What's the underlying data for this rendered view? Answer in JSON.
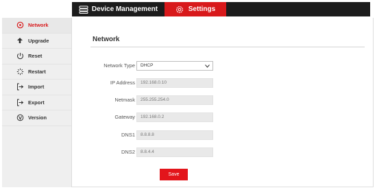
{
  "header": {
    "tabs": [
      {
        "label": "Device Management",
        "icon": "device-management-icon"
      },
      {
        "label": "Settings",
        "icon": "gear-icon",
        "active": true
      }
    ]
  },
  "sidebar": {
    "items": [
      {
        "label": "Network",
        "icon": "network-icon",
        "active": true
      },
      {
        "label": "Upgrade",
        "icon": "upgrade-arrow-icon"
      },
      {
        "label": "Reset",
        "icon": "reset-icon"
      },
      {
        "label": "Restart",
        "icon": "restart-icon"
      },
      {
        "label": "Import",
        "icon": "import-icon"
      },
      {
        "label": "Export",
        "icon": "export-icon"
      },
      {
        "label": "Version",
        "icon": "version-icon"
      }
    ]
  },
  "main": {
    "title": "Network",
    "fields": [
      {
        "label": "Network Type",
        "value": "DHCP",
        "type": "select"
      },
      {
        "label": "IP Address",
        "value": "192.168.0.10"
      },
      {
        "label": "Netmask",
        "value": "255.255.254.0"
      },
      {
        "label": "Gateway",
        "value": "192.168.0.2"
      },
      {
        "label": "DNS1",
        "value": "8.8.8.8"
      },
      {
        "label": "DNS2",
        "value": "8.8.4.4"
      }
    ],
    "save_label": "Save"
  },
  "colors": {
    "accent": "#d8191b",
    "topbar": "#1c1c1c",
    "sidebar_bg": "#efefef",
    "field_bg": "#e9e9e9"
  }
}
